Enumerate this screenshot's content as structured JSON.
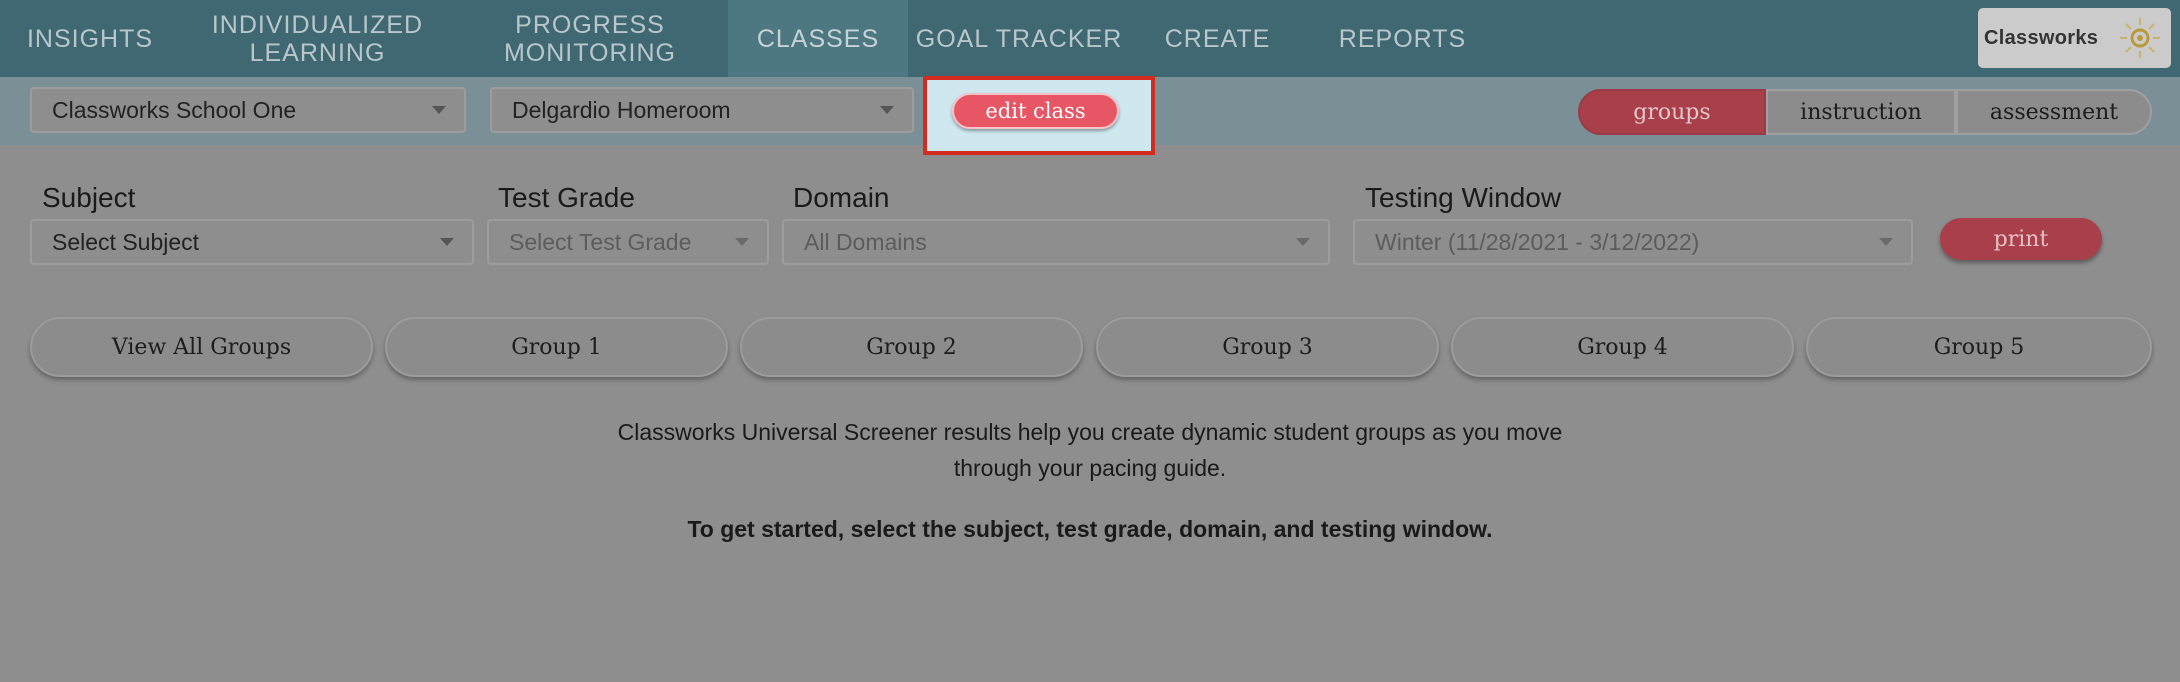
{
  "nav": {
    "items": [
      {
        "label": "INSIGHTS"
      },
      {
        "label": "INDIVIDUALIZED LEARNING"
      },
      {
        "label": "PROGRESS MONITORING"
      },
      {
        "label": "CLASSES"
      },
      {
        "label": "GOAL TRACKER"
      },
      {
        "label": "CREATE"
      },
      {
        "label": "REPORTS"
      }
    ],
    "active": "CLASSES",
    "logo_text": "Classworks"
  },
  "subbar": {
    "school_select": "Classworks School One",
    "class_select": "Delgardio Homeroom",
    "edit_class_label": "edit class",
    "view_tabs": [
      "groups",
      "instruction",
      "assessment"
    ],
    "active_tab": "groups"
  },
  "filters": {
    "subject": {
      "label": "Subject",
      "value": "Select Subject"
    },
    "test_grade": {
      "label": "Test Grade",
      "value": "Select Test Grade"
    },
    "domain": {
      "label": "Domain",
      "value": "All Domains"
    },
    "testing_window": {
      "label": "Testing Window",
      "value": "Winter (11/28/2021 - 3/12/2022)"
    },
    "print_label": "print"
  },
  "groups": [
    "View All Groups",
    "Group 1",
    "Group 2",
    "Group 3",
    "Group 4",
    "Group 5"
  ],
  "message": {
    "line1": "Classworks Universal Screener results help you create dynamic student groups as you move",
    "line2": "through your pacing guide.",
    "bold": "To get started, select the subject, test grade, domain, and testing window."
  },
  "colors": {
    "nav_bg": "#3f6872",
    "accent_red": "#e75665",
    "active_tab": "#a83f4b",
    "highlight_border": "#d32b1f"
  }
}
